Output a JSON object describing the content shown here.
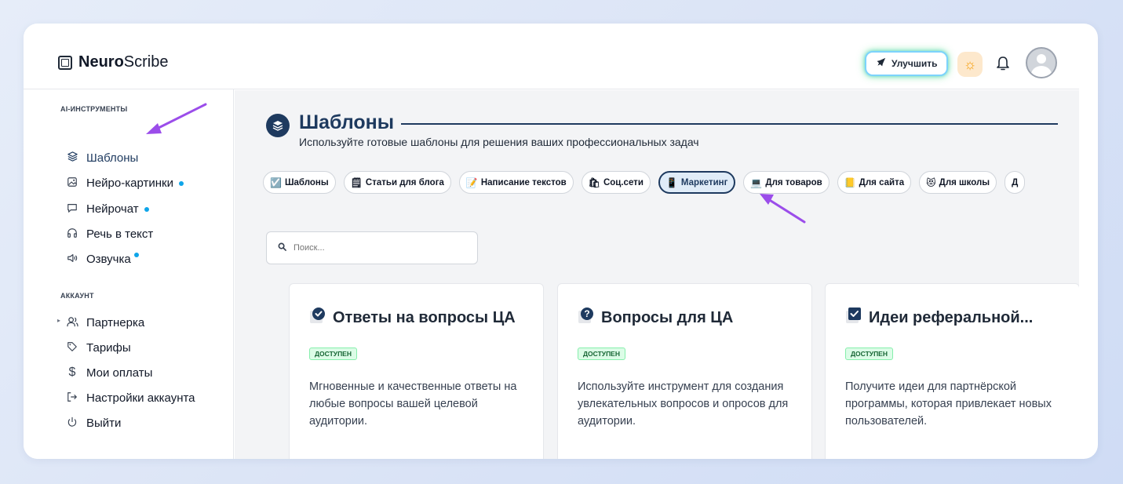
{
  "app": {
    "name_bold": "Neuro",
    "name_rest": "Scribe"
  },
  "header": {
    "upgrade_label": "Улучшить"
  },
  "sidebar": {
    "sections": [
      {
        "title": "AI-ИНСТРУМЕНТЫ"
      },
      {
        "title": "АККАУНТ"
      }
    ],
    "items": [
      {
        "label": "Шаблоны",
        "icon": "layers-icon"
      },
      {
        "label": "Нейро-картинки",
        "icon": "image-icon"
      },
      {
        "label": "Нейрочат",
        "icon": "chat-icon"
      },
      {
        "label": "Речь в текст",
        "icon": "headphones-icon"
      },
      {
        "label": "Озвучка",
        "icon": "speaker-icon"
      },
      {
        "label": "Партнерка",
        "icon": "users-icon"
      },
      {
        "label": "Тарифы",
        "icon": "tag-icon"
      },
      {
        "label": "Мои оплаты",
        "icon": "dollar-icon"
      },
      {
        "label": "Настройки аккаунта",
        "icon": "logout-arrow-icon"
      },
      {
        "label": "Выйти",
        "icon": "power-icon"
      }
    ]
  },
  "page": {
    "title": "Шаблоны",
    "subtitle": "Используйте готовые шаблоны для решения ваших профессиональных задач"
  },
  "filters": [
    {
      "emoji": "☑️",
      "label": "Шаблоны"
    },
    {
      "emoji": "🗒",
      "label": "Статьи для блога"
    },
    {
      "emoji": "📝",
      "label": "Написание текстов"
    },
    {
      "emoji": "🛍",
      "label": "Соц.сети"
    },
    {
      "emoji": "📱",
      "label": "Маркетинг"
    },
    {
      "emoji": "💻",
      "label": "Для товаров"
    },
    {
      "emoji": "📒",
      "label": "Для сайта"
    },
    {
      "emoji": "😻",
      "label": "Для школы"
    },
    {
      "emoji": "",
      "label": "Д"
    }
  ],
  "search": {
    "placeholder": "Поиск..."
  },
  "cards": [
    {
      "title": "Ответы на вопросы ЦА",
      "badge": "доступен",
      "desc": "Мгновенные и качественные ответы на любые вопросы вашей целевой аудитории."
    },
    {
      "title": "Вопросы для ЦА",
      "badge": "доступен",
      "desc": "Используйте инструмент для создания увлекательных вопросов и опросов для аудитории."
    },
    {
      "title": "Идеи реферальной...",
      "badge": "доступен",
      "desc": "Получите идеи для партнёрской программы, которая привлекает новых пользователей."
    }
  ],
  "colors": {
    "accent": "#1e3a5f",
    "dot": "#0ea5e9",
    "annotation_arrow": "#9b4dea"
  }
}
